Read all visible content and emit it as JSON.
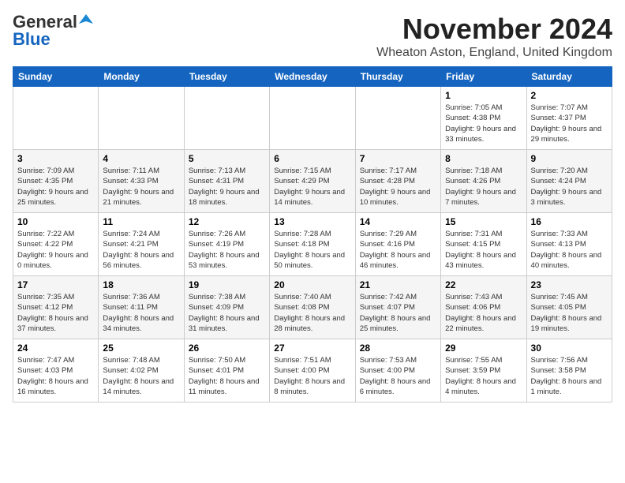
{
  "logo": {
    "general": "General",
    "blue": "Blue"
  },
  "title": "November 2024",
  "location": "Wheaton Aston, England, United Kingdom",
  "days_of_week": [
    "Sunday",
    "Monday",
    "Tuesday",
    "Wednesday",
    "Thursday",
    "Friday",
    "Saturday"
  ],
  "weeks": [
    [
      {
        "day": "",
        "info": ""
      },
      {
        "day": "",
        "info": ""
      },
      {
        "day": "",
        "info": ""
      },
      {
        "day": "",
        "info": ""
      },
      {
        "day": "",
        "info": ""
      },
      {
        "day": "1",
        "info": "Sunrise: 7:05 AM\nSunset: 4:38 PM\nDaylight: 9 hours and 33 minutes."
      },
      {
        "day": "2",
        "info": "Sunrise: 7:07 AM\nSunset: 4:37 PM\nDaylight: 9 hours and 29 minutes."
      }
    ],
    [
      {
        "day": "3",
        "info": "Sunrise: 7:09 AM\nSunset: 4:35 PM\nDaylight: 9 hours and 25 minutes."
      },
      {
        "day": "4",
        "info": "Sunrise: 7:11 AM\nSunset: 4:33 PM\nDaylight: 9 hours and 21 minutes."
      },
      {
        "day": "5",
        "info": "Sunrise: 7:13 AM\nSunset: 4:31 PM\nDaylight: 9 hours and 18 minutes."
      },
      {
        "day": "6",
        "info": "Sunrise: 7:15 AM\nSunset: 4:29 PM\nDaylight: 9 hours and 14 minutes."
      },
      {
        "day": "7",
        "info": "Sunrise: 7:17 AM\nSunset: 4:28 PM\nDaylight: 9 hours and 10 minutes."
      },
      {
        "day": "8",
        "info": "Sunrise: 7:18 AM\nSunset: 4:26 PM\nDaylight: 9 hours and 7 minutes."
      },
      {
        "day": "9",
        "info": "Sunrise: 7:20 AM\nSunset: 4:24 PM\nDaylight: 9 hours and 3 minutes."
      }
    ],
    [
      {
        "day": "10",
        "info": "Sunrise: 7:22 AM\nSunset: 4:22 PM\nDaylight: 9 hours and 0 minutes."
      },
      {
        "day": "11",
        "info": "Sunrise: 7:24 AM\nSunset: 4:21 PM\nDaylight: 8 hours and 56 minutes."
      },
      {
        "day": "12",
        "info": "Sunrise: 7:26 AM\nSunset: 4:19 PM\nDaylight: 8 hours and 53 minutes."
      },
      {
        "day": "13",
        "info": "Sunrise: 7:28 AM\nSunset: 4:18 PM\nDaylight: 8 hours and 50 minutes."
      },
      {
        "day": "14",
        "info": "Sunrise: 7:29 AM\nSunset: 4:16 PM\nDaylight: 8 hours and 46 minutes."
      },
      {
        "day": "15",
        "info": "Sunrise: 7:31 AM\nSunset: 4:15 PM\nDaylight: 8 hours and 43 minutes."
      },
      {
        "day": "16",
        "info": "Sunrise: 7:33 AM\nSunset: 4:13 PM\nDaylight: 8 hours and 40 minutes."
      }
    ],
    [
      {
        "day": "17",
        "info": "Sunrise: 7:35 AM\nSunset: 4:12 PM\nDaylight: 8 hours and 37 minutes."
      },
      {
        "day": "18",
        "info": "Sunrise: 7:36 AM\nSunset: 4:11 PM\nDaylight: 8 hours and 34 minutes."
      },
      {
        "day": "19",
        "info": "Sunrise: 7:38 AM\nSunset: 4:09 PM\nDaylight: 8 hours and 31 minutes."
      },
      {
        "day": "20",
        "info": "Sunrise: 7:40 AM\nSunset: 4:08 PM\nDaylight: 8 hours and 28 minutes."
      },
      {
        "day": "21",
        "info": "Sunrise: 7:42 AM\nSunset: 4:07 PM\nDaylight: 8 hours and 25 minutes."
      },
      {
        "day": "22",
        "info": "Sunrise: 7:43 AM\nSunset: 4:06 PM\nDaylight: 8 hours and 22 minutes."
      },
      {
        "day": "23",
        "info": "Sunrise: 7:45 AM\nSunset: 4:05 PM\nDaylight: 8 hours and 19 minutes."
      }
    ],
    [
      {
        "day": "24",
        "info": "Sunrise: 7:47 AM\nSunset: 4:03 PM\nDaylight: 8 hours and 16 minutes."
      },
      {
        "day": "25",
        "info": "Sunrise: 7:48 AM\nSunset: 4:02 PM\nDaylight: 8 hours and 14 minutes."
      },
      {
        "day": "26",
        "info": "Sunrise: 7:50 AM\nSunset: 4:01 PM\nDaylight: 8 hours and 11 minutes."
      },
      {
        "day": "27",
        "info": "Sunrise: 7:51 AM\nSunset: 4:00 PM\nDaylight: 8 hours and 8 minutes."
      },
      {
        "day": "28",
        "info": "Sunrise: 7:53 AM\nSunset: 4:00 PM\nDaylight: 8 hours and 6 minutes."
      },
      {
        "day": "29",
        "info": "Sunrise: 7:55 AM\nSunset: 3:59 PM\nDaylight: 8 hours and 4 minutes."
      },
      {
        "day": "30",
        "info": "Sunrise: 7:56 AM\nSunset: 3:58 PM\nDaylight: 8 hours and 1 minute."
      }
    ]
  ]
}
